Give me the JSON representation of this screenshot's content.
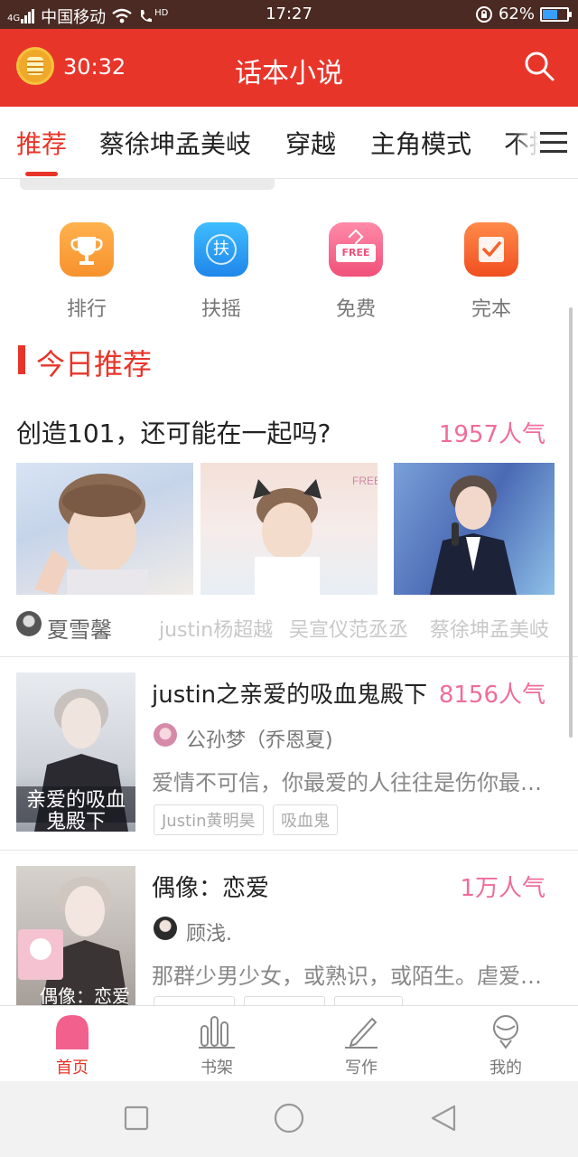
{
  "status_bar": {
    "signal": "4G",
    "carrier": "中国移动",
    "hd": "HD",
    "time": "17:27",
    "battery_percent_label": "62%",
    "battery_level": 0.62
  },
  "app_bar": {
    "timer": "30:32",
    "title": "话本小说"
  },
  "tabs": [
    {
      "label": "推荐",
      "active": true
    },
    {
      "label": "蔡徐坤孟美岐"
    },
    {
      "label": "穿越"
    },
    {
      "label": "主角模式"
    },
    {
      "label": "不择"
    }
  ],
  "quick_links": [
    {
      "label": "排行",
      "icon": "trophy-icon",
      "color": "#f7922e"
    },
    {
      "label": "扶摇",
      "icon": "fuyao-icon",
      "glyph": "扶",
      "color": "#2b9df0"
    },
    {
      "label": "免费",
      "icon": "free-icon",
      "glyph": "FREE",
      "color": "#f35e86"
    },
    {
      "label": "完本",
      "icon": "completed-icon",
      "color": "#f5622b"
    }
  ],
  "section": {
    "title": "今日推荐"
  },
  "featured": {
    "title": "创造101，还可能在一起吗?",
    "popularity": "1957人气",
    "author": "夏雪馨",
    "tags": [
      "justin杨超越",
      "吴宣仪范丞丞",
      "蔡徐坤孟美岐"
    ]
  },
  "books": [
    {
      "title": "justin之亲爱的吸血鬼殿下",
      "popularity": "8156人气",
      "author": "公孙梦（乔恩夏)",
      "description": "爱情不可信，你最爱的人往往是伤你最深的人",
      "tags": [
        "Justin黄明昊",
        "吸血鬼"
      ],
      "cover_text": "亲爱的吸血鬼殿下"
    },
    {
      "title": "偶像：恋爱",
      "popularity": "1万人气",
      "author": "顾浅.",
      "description": "那群少男少女，或熟识，或陌生。虐爱情深",
      "tags": [
        "",
        "",
        ""
      ],
      "cover_text": "偶像：恋爱"
    }
  ],
  "bottom_nav": [
    {
      "label": "首页",
      "icon": "home-icon",
      "active": true
    },
    {
      "label": "书架",
      "icon": "bookshelf-icon"
    },
    {
      "label": "写作",
      "icon": "pen-icon"
    },
    {
      "label": "我的",
      "icon": "profile-icon"
    }
  ],
  "colors": {
    "brand_red": "#e8352a",
    "popularity_pink": "#f06c9b"
  }
}
